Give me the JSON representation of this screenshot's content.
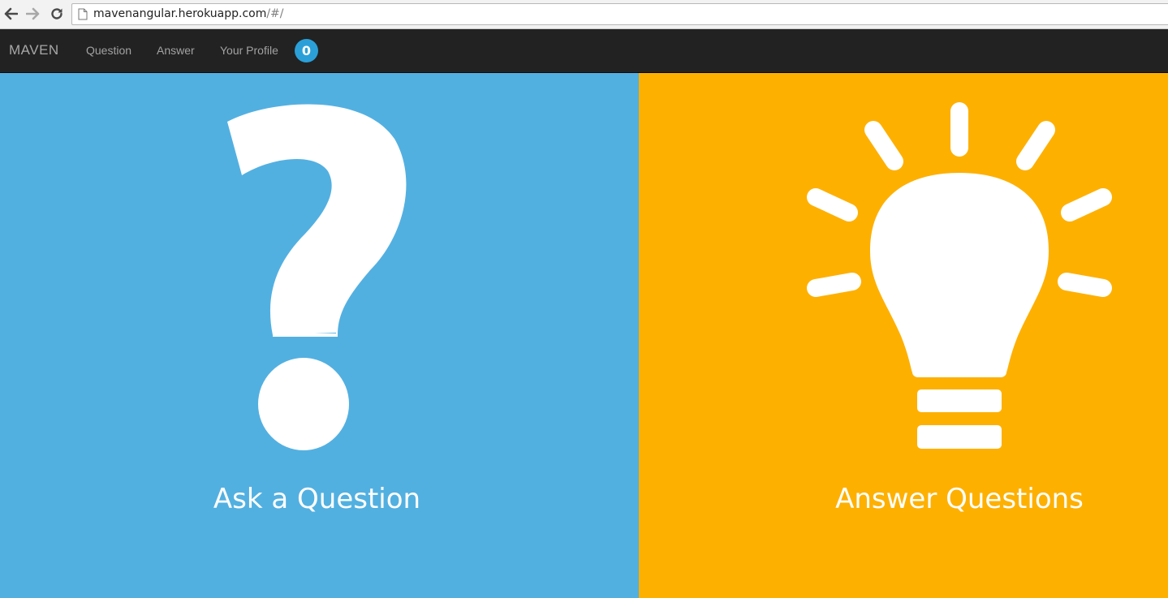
{
  "browser": {
    "url_host": "mavenangular.herokuapp.com",
    "url_path": "/#/",
    "icons": [
      "back-arrow-icon",
      "forward-arrow-icon",
      "reload-icon",
      "page-icon"
    ]
  },
  "navbar": {
    "brand": "MAVEN",
    "links": [
      "Question",
      "Answer",
      "Your Profile"
    ],
    "badge_count": "0"
  },
  "panels": {
    "ask": {
      "label": "Ask a Question",
      "icon": "question-mark-icon",
      "color": "#52b0e1"
    },
    "answer": {
      "label": "Answer Questions",
      "icon": "lightbulb-icon",
      "color": "#feb000"
    }
  },
  "colors": {
    "navbar_bg": "#222222",
    "badge_bg": "#2ba0d8",
    "ask_bg": "#52b0e1",
    "answer_bg": "#feb000"
  }
}
